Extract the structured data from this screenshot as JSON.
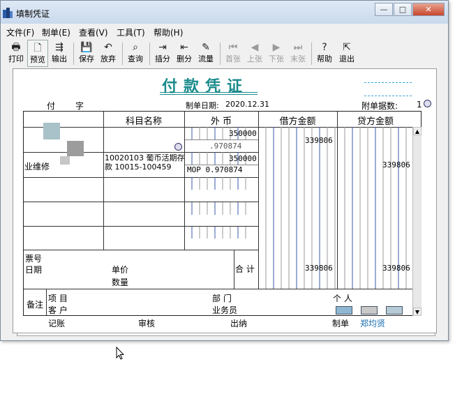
{
  "window": {
    "title": "填制凭证",
    "minimize_glyph": "—",
    "maximize_glyph": "□",
    "close_glyph": "✕"
  },
  "menu": [
    "文件(F)",
    "制单(E)",
    "查看(V)",
    "工具(T)",
    "帮助(H)"
  ],
  "toolbar": [
    {
      "label": "打印",
      "icon": "printer-icon",
      "glyph": "🖶"
    },
    {
      "label": "预览",
      "icon": "preview-icon",
      "glyph": "🗋"
    },
    {
      "label": "输出",
      "icon": "export-icon",
      "glyph": "⇶"
    },
    {
      "label": "保存",
      "icon": "save-icon",
      "glyph": "💾"
    },
    {
      "label": "放弃",
      "icon": "undo-icon",
      "glyph": "↶"
    },
    {
      "label": "查询",
      "icon": "binoculars-icon",
      "glyph": "⌕"
    },
    {
      "label": "插分",
      "icon": "insert-row-icon",
      "glyph": "⇥"
    },
    {
      "label": "删分",
      "icon": "delete-row-icon",
      "glyph": "⇤"
    },
    {
      "label": "流量",
      "icon": "cashflow-icon",
      "glyph": "✎"
    },
    {
      "label": "首张",
      "icon": "first-icon",
      "glyph": "⏮"
    },
    {
      "label": "上张",
      "icon": "prev-icon",
      "glyph": "◀"
    },
    {
      "label": "下张",
      "icon": "next-icon",
      "glyph": "▶"
    },
    {
      "label": "末张",
      "icon": "last-icon",
      "glyph": "⏭"
    },
    {
      "label": "帮助",
      "icon": "help-icon",
      "glyph": "?"
    },
    {
      "label": "退出",
      "icon": "exit-icon",
      "glyph": "⇱"
    }
  ],
  "voucher": {
    "title": "付款凭证",
    "word_label": "付",
    "word_suffix": "字",
    "date_label": "制单日期:",
    "date": "2020.12.31",
    "attach_label": "附单据数:",
    "attach_count": "1",
    "col_subject": "科目名称",
    "col_foreign": "外 币",
    "col_debit": "借方金额",
    "col_credit": "贷方金额",
    "rows": [
      {
        "summary": "",
        "subject": "",
        "fx_amount": "350000",
        "rate": ".970874",
        "debit": "339806",
        "credit": ""
      },
      {
        "summary": "业维修",
        "subject": "10020103 葡币活期存款 10015-100459",
        "fx_amount": "350000",
        "rate": "MOP 0.970874",
        "debit": "",
        "credit": "339806"
      }
    ],
    "footer_left": [
      "票号",
      "日期"
    ],
    "price_label": "单价",
    "qty_label": "数量",
    "total_label": "合 计",
    "total_debit": "339806",
    "total_credit": "339806",
    "remarks_label": "备注",
    "project_label": "项 目",
    "customer_label": "客 户",
    "dept_label": "部 门",
    "salesperson_label": "业务员",
    "person_label": "个 人",
    "sign": {
      "bookkeep": "记账",
      "audit": "审核",
      "cashier": "出纳",
      "maker": "制单",
      "maker_name": "郑均贤"
    }
  },
  "colors": {
    "title": "#1a8a8c",
    "dotline": "#3aa6d8",
    "debit_red": "#c0392b",
    "credit_blue": "#3a5aa8"
  }
}
